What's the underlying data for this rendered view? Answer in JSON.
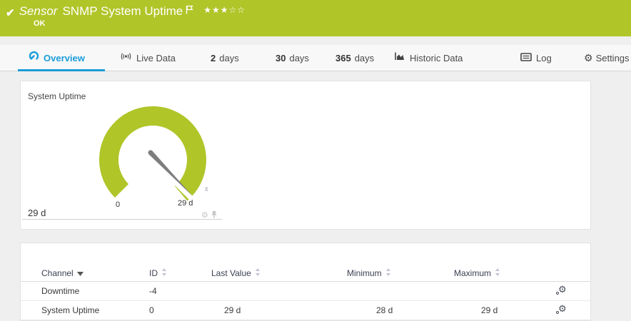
{
  "header": {
    "kind": "Sensor",
    "title": "SNMP System Uptime",
    "status": "OK",
    "rating": {
      "filled_stars": "★★★",
      "empty_stars": "☆☆"
    }
  },
  "tabs": {
    "overview": "Overview",
    "live_data": "Live Data",
    "days2_num": "2",
    "days2_label": "days",
    "days30_num": "30",
    "days30_label": "days",
    "days365_num": "365",
    "days365_label": "days",
    "historic": "Historic Data",
    "log": "Log",
    "settings": "Settings"
  },
  "gauge_panel": {
    "title": "System Uptime",
    "current_value": "29 d",
    "scale_min": "0",
    "scale_max": "29 d",
    "marker_label": "x̄"
  },
  "chart_data": {
    "type": "gauge",
    "title": "System Uptime",
    "min": 0,
    "max_label": "29 d",
    "value_label": "29 d",
    "needle_position": "max"
  },
  "channels_table": {
    "columns": {
      "channel": "Channel",
      "id": "ID",
      "last_value": "Last Value",
      "minimum": "Minimum",
      "maximum": "Maximum"
    },
    "rows": [
      {
        "channel": "Downtime",
        "id": "-4",
        "last_value": "",
        "minimum": "",
        "maximum": ""
      },
      {
        "channel": "System Uptime",
        "id": "0",
        "last_value": "29 d",
        "minimum": "28 d",
        "maximum": "29 d"
      }
    ]
  },
  "colors": {
    "brand_green": "#b0c528",
    "accent_blue": "#1b9dd9",
    "needle_gray": "#7d7d7d"
  }
}
